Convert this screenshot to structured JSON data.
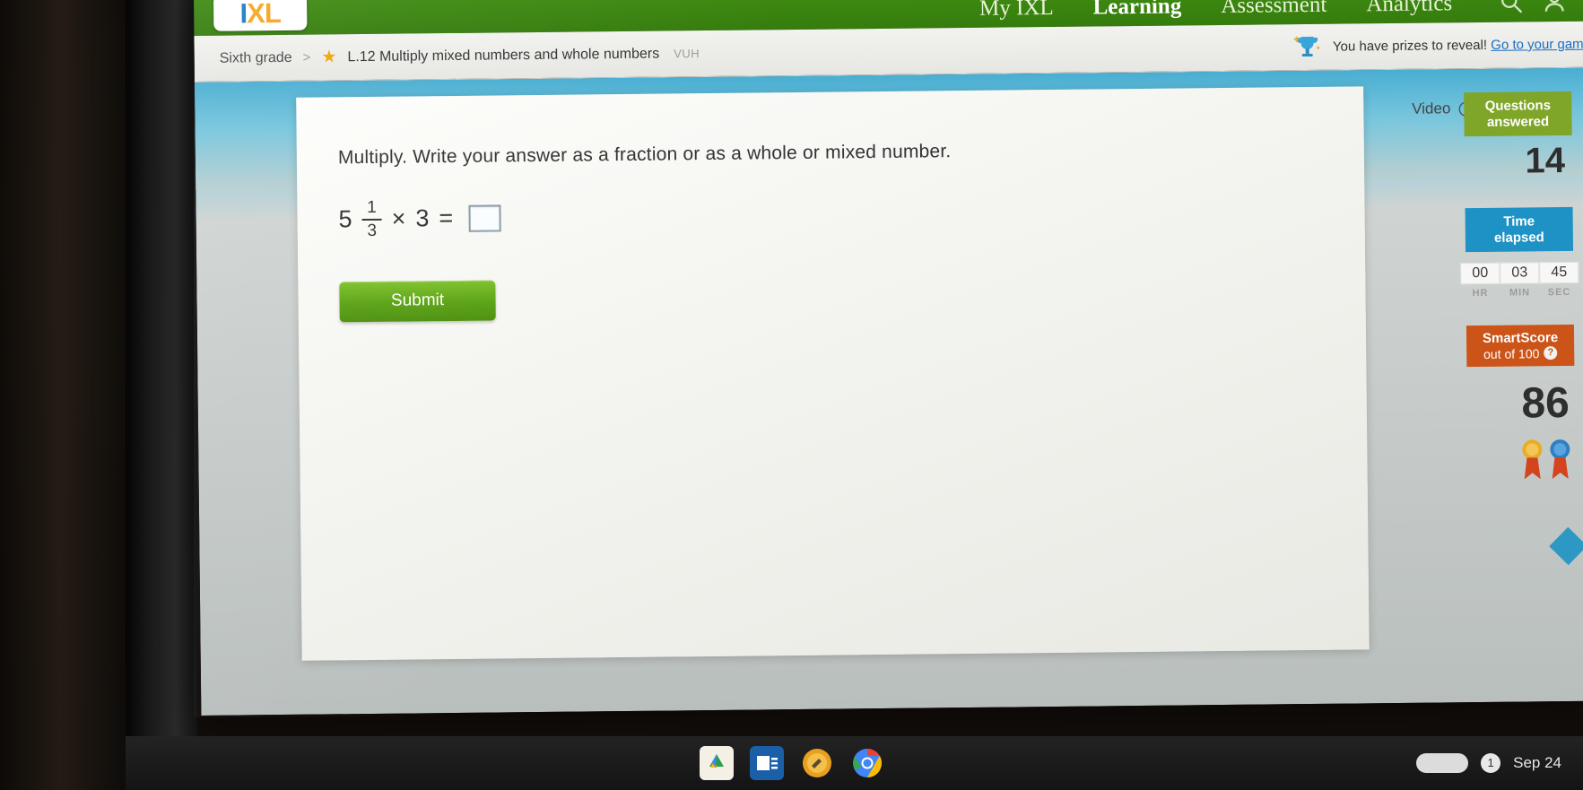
{
  "nav": {
    "logo": {
      "part1": "I",
      "part2": "X",
      "part3": "L"
    },
    "tabs": [
      {
        "label": "My IXL",
        "active": false
      },
      {
        "label": "Learning",
        "active": true
      },
      {
        "label": "Assessment",
        "active": false
      },
      {
        "label": "Analytics",
        "active": false
      }
    ],
    "search_icon": "search-icon",
    "account_icon": "account-icon"
  },
  "breadcrumb": {
    "grade": "Sixth grade",
    "separator": ">",
    "star_icon": "star-icon",
    "skill": "L.12 Multiply mixed numbers and whole numbers",
    "code": "VUH"
  },
  "prizes": {
    "trophy_icon": "trophy-icon",
    "message": "You have prizes to reveal!",
    "link": "Go to your gam"
  },
  "question": {
    "prompt": "Multiply. Write your answer as a fraction or as a whole or mixed number.",
    "whole": "5",
    "numerator": "1",
    "denominator": "3",
    "times": "×",
    "factor": "3",
    "equals": "=",
    "answer_value": "",
    "answer_placeholder": ""
  },
  "submit": {
    "label": "Submit"
  },
  "sidebar": {
    "video": {
      "label": "Video",
      "icon": "play-circle-icon"
    },
    "questions_answered": {
      "label_line1": "Questions",
      "label_line2": "answered",
      "value": "14"
    },
    "time_elapsed": {
      "label_line1": "Time",
      "label_line2": "elapsed",
      "hr_value": "00",
      "hr_label": "HR",
      "min_value": "03",
      "min_label": "MIN",
      "sec_value": "45",
      "sec_label": "SEC"
    },
    "smartscore": {
      "label": "SmartScore",
      "sub": "out of 100",
      "help_icon": "help-icon",
      "value": "86"
    },
    "awards": [
      {
        "name": "gold-ribbon-icon",
        "color": "#d89b1a"
      },
      {
        "name": "blue-ribbon-icon",
        "color": "#2f7fc4"
      }
    ]
  },
  "taskbar": {
    "apps": [
      {
        "name": "drive-icon",
        "color": "#f9c22e"
      },
      {
        "name": "slides-icon",
        "color": "#d4511e"
      },
      {
        "name": "paint-icon",
        "color": "#e8a020"
      },
      {
        "name": "chrome-icon",
        "color": "#4285f4"
      }
    ],
    "notification_count": "1",
    "date": "Sep 24"
  },
  "colors": {
    "brand_green": "#3f8c12",
    "submit_green": "#5aa214",
    "answered_green": "#7fa628",
    "time_blue": "#1e92c4",
    "smartscore_orange": "#cc5418",
    "star_gold": "#f0a500"
  }
}
